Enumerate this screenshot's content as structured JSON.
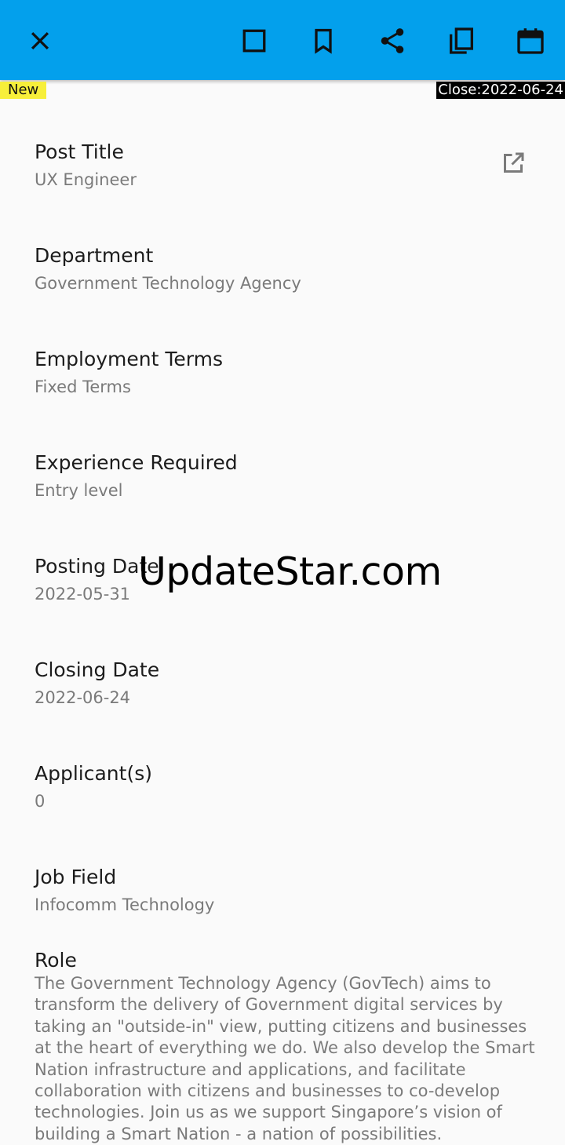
{
  "toolbar": {
    "icons": [
      "close-icon",
      "square-icon",
      "bookmark-icon",
      "share-icon",
      "copy-icon",
      "calendar-icon"
    ],
    "accent_color": "#03a0ec"
  },
  "badges": {
    "new": "New",
    "close": "Close:2022-06-24"
  },
  "fields": [
    {
      "label": "Post Title",
      "value": "UX Engineer"
    },
    {
      "label": "Department",
      "value": "Government Technology Agency"
    },
    {
      "label": "Employment Terms",
      "value": "Fixed Terms"
    },
    {
      "label": "Experience Required",
      "value": "Entry level"
    },
    {
      "label": "Posting Date",
      "value": "2022-05-31"
    },
    {
      "label": "Closing Date",
      "value": "2022-06-24"
    },
    {
      "label": "Applicant(s)",
      "value": "0"
    },
    {
      "label": "Job Field",
      "value": "Infocomm Technology"
    }
  ],
  "role": {
    "label": "Role",
    "value": "The Government Technology Agency (GovTech) aims to transform the delivery of Government digital services by taking an \"outside-in\" view, putting citizens and businesses at the heart of everything we do. We also develop the Smart Nation infrastructure and applications, and facilitate collaboration with citizens and businesses to co-develop technologies. Join us as we support Singapore’s vision of building a Smart Nation - a nation of possibilities."
  },
  "watermark": "UpdateStar.com"
}
